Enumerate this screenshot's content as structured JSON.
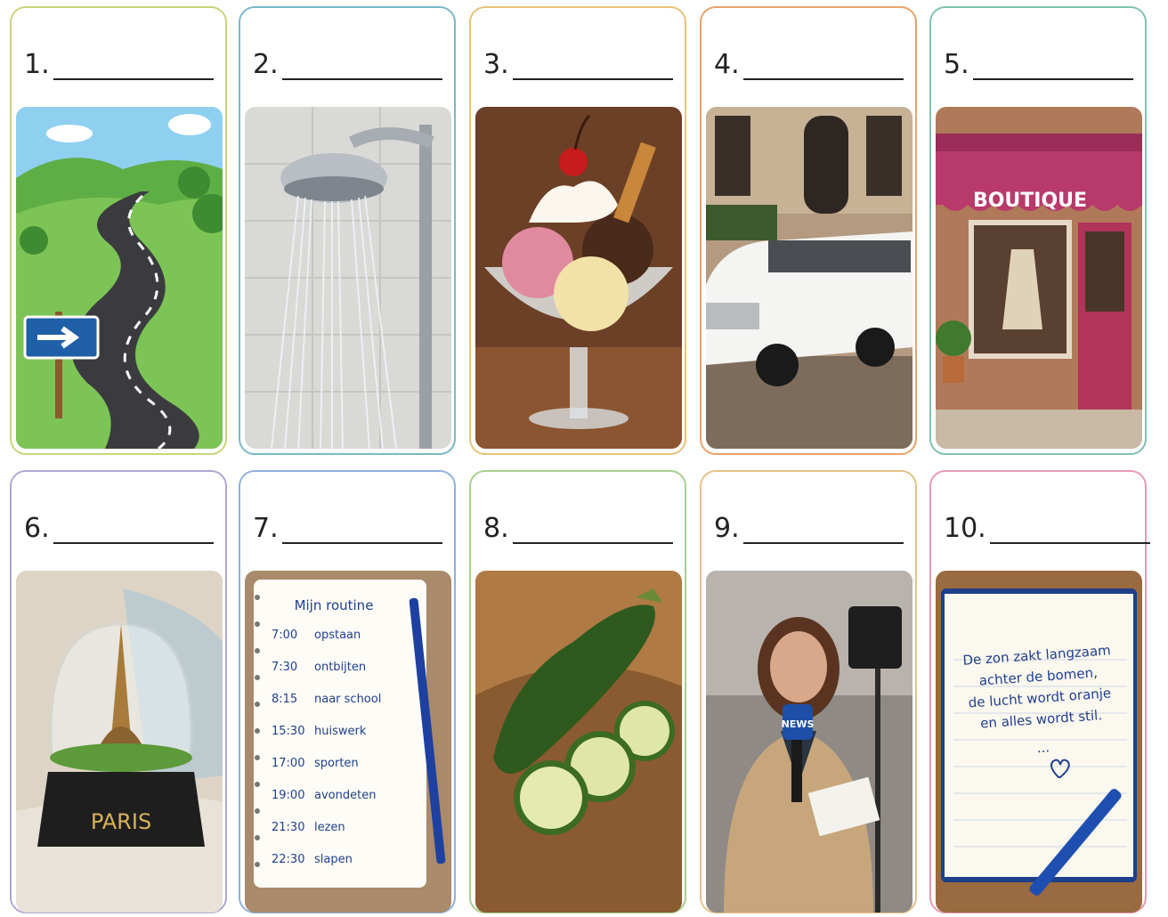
{
  "cards": [
    {
      "number": "1.",
      "border": "#c8d67a"
    },
    {
      "number": "2.",
      "border": "#7bb8c9"
    },
    {
      "number": "3.",
      "border": "#e8c37a"
    },
    {
      "number": "4.",
      "border": "#e8a36a"
    },
    {
      "number": "5.",
      "border": "#7fc2b2"
    },
    {
      "number": "6.",
      "border": "#b3a6d6"
    },
    {
      "number": "7.",
      "border": "#8fb0dc"
    },
    {
      "number": "8.",
      "border": "#a8cf8e"
    },
    {
      "number": "9.",
      "border": "#e6c28a"
    },
    {
      "number": "10.",
      "border": "#e79bb0"
    }
  ],
  "images": {
    "boutique_sign": "BOUTIQUE",
    "paris_label": "PARIS",
    "news_label": "NEWS",
    "routine": {
      "title": "Mijn routine",
      "items": [
        {
          "time": "7:00",
          "task": "opstaan"
        },
        {
          "time": "7:30",
          "task": "ontbijten"
        },
        {
          "time": "8:15",
          "task": "naar school"
        },
        {
          "time": "15:30",
          "task": "huiswerk"
        },
        {
          "time": "17:00",
          "task": "sporten"
        },
        {
          "time": "19:00",
          "task": "avondeten"
        },
        {
          "time": "21:30",
          "task": "lezen"
        },
        {
          "time": "22:30",
          "task": "slapen"
        }
      ]
    },
    "diary": {
      "lines": [
        "De zon zakt langzaam",
        "achter de bomen,",
        "de lucht wordt oranje",
        "en alles wordt stil."
      ],
      "ellipsis": "..."
    }
  }
}
